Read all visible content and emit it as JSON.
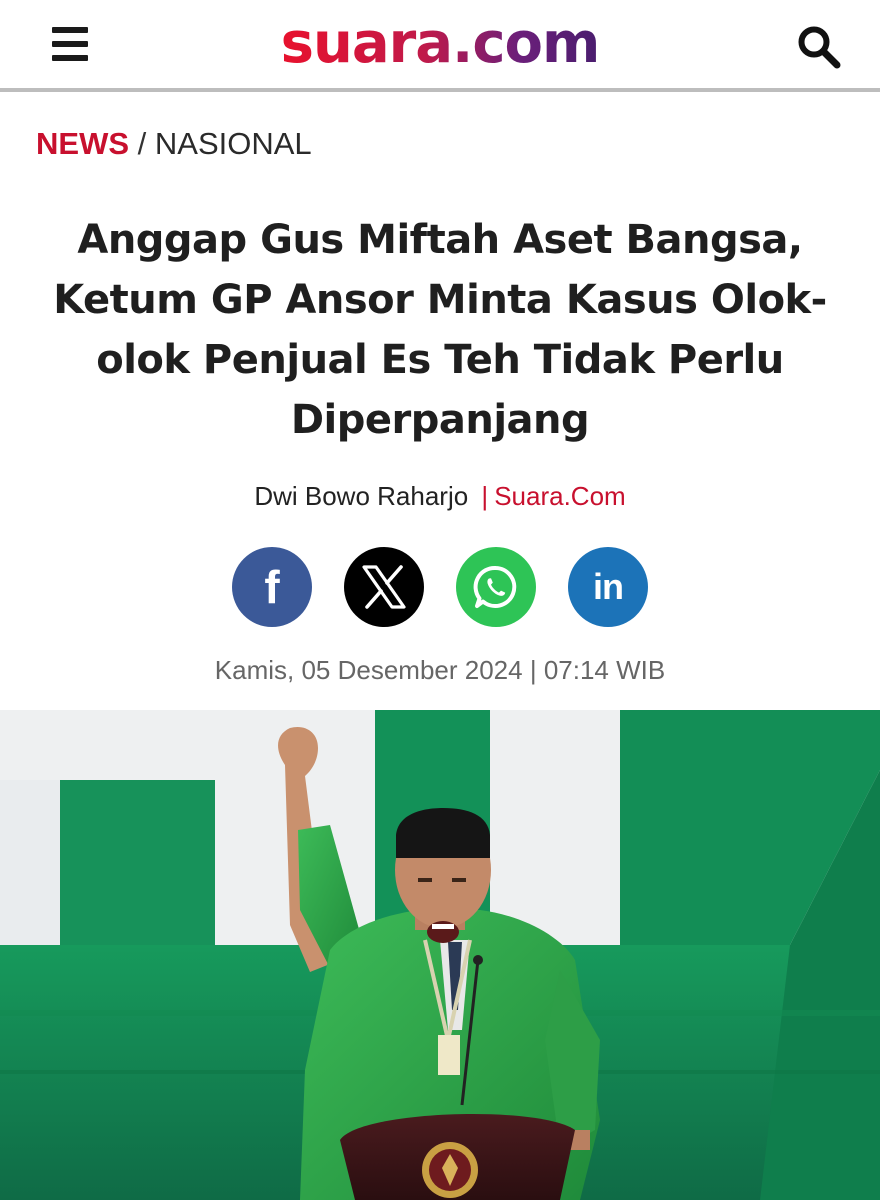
{
  "header": {
    "logo_text": "suara.com",
    "menu_icon": "hamburger-menu-icon",
    "search_icon": "search-icon"
  },
  "breadcrumb": {
    "category": "NEWS",
    "separator": "/",
    "section": "NASIONAL"
  },
  "article": {
    "title_lines": [
      "Anggap Gus Miftah Aset Bangsa,",
      "Ketum GP Ansor Minta Kasus Olok-",
      "olok Penjual Es Teh Tidak Perlu",
      "Diperpanjang"
    ],
    "author": "Dwi Bowo Raharjo",
    "byline_separator": "|",
    "source": "Suara.Com",
    "date": "Kamis, 05 Desember 2024",
    "date_separator": "|",
    "time": "07:14 WIB"
  },
  "share": {
    "buttons": [
      {
        "name": "facebook",
        "icon": "facebook-icon",
        "label": "f",
        "color": "#3b5998"
      },
      {
        "name": "x",
        "icon": "x-icon",
        "color": "#000000"
      },
      {
        "name": "whatsapp",
        "icon": "whatsapp-icon",
        "color": "#2ec456"
      },
      {
        "name": "linkedin",
        "icon": "linkedin-icon",
        "label": "in",
        "color": "#1c73b8"
      }
    ]
  },
  "colors": {
    "accent_red": "#c8102e",
    "hero_green": "#1f9a55"
  }
}
